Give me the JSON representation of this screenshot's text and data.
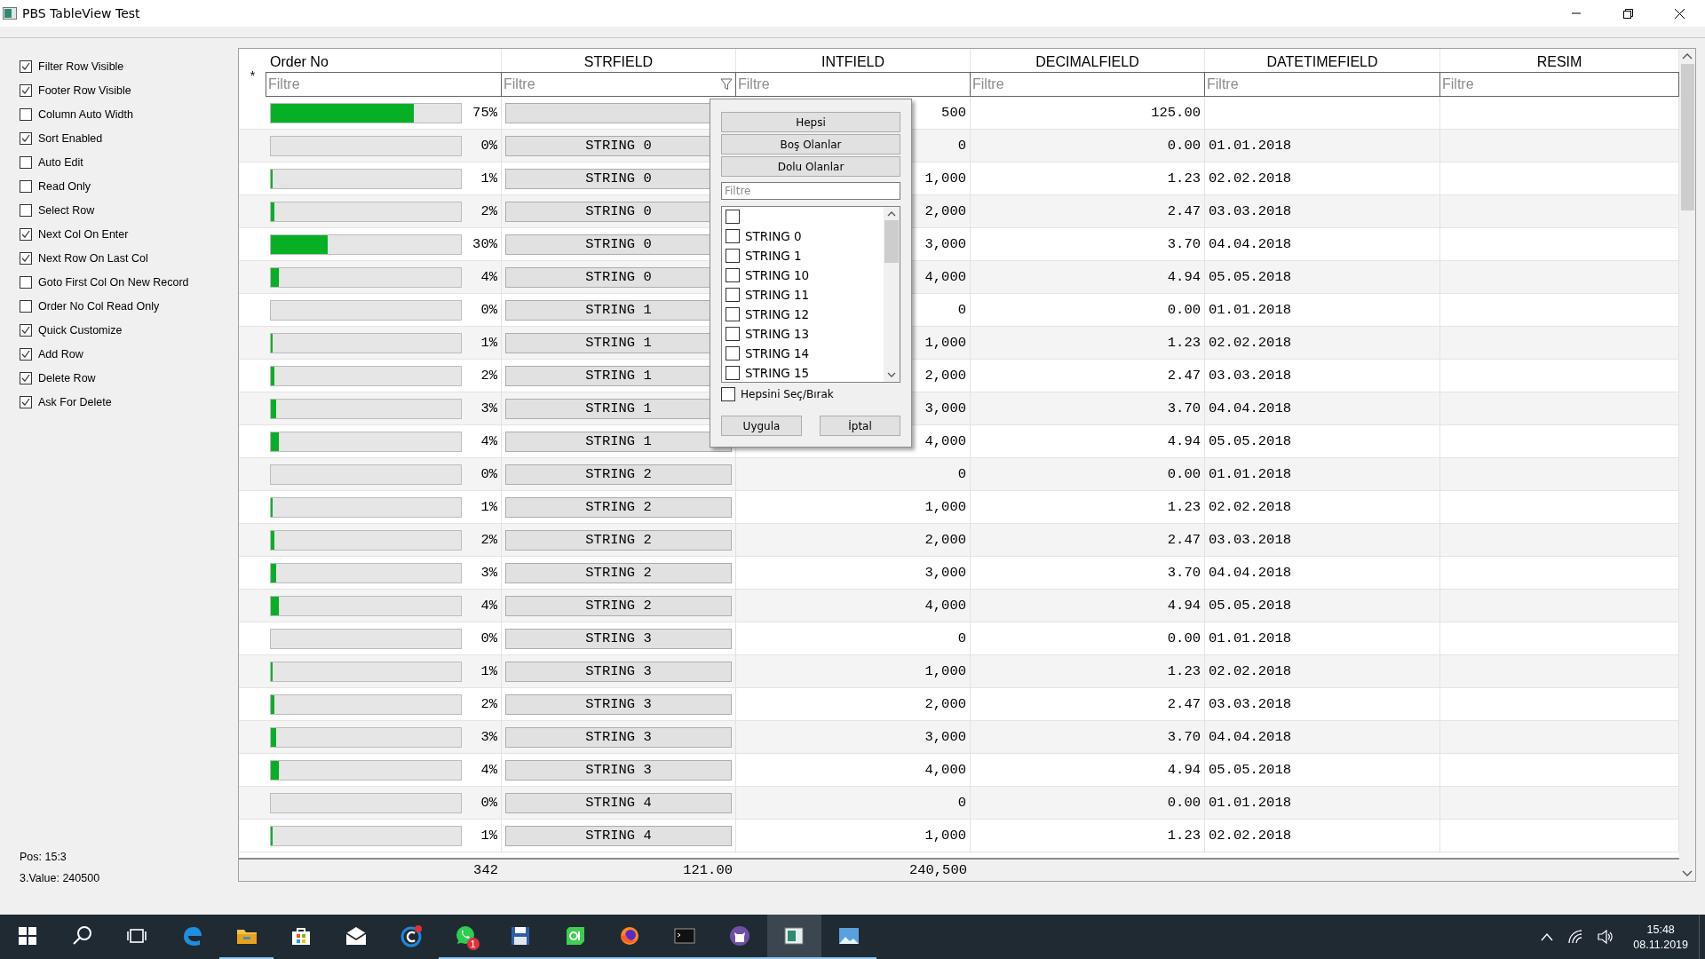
{
  "window": {
    "title": "PBS TableView Test"
  },
  "options": [
    {
      "label": "Filter Row Visible",
      "checked": true
    },
    {
      "label": "Footer Row Visible",
      "checked": true
    },
    {
      "label": "Column Auto Width",
      "checked": false
    },
    {
      "label": "Sort Enabled",
      "checked": true
    },
    {
      "label": "Auto Edit",
      "checked": false
    },
    {
      "label": "Read Only",
      "checked": false
    },
    {
      "label": "Select Row",
      "checked": false
    },
    {
      "label": "Next Col On Enter",
      "checked": true
    },
    {
      "label": "Next Row On Last Col",
      "checked": true
    },
    {
      "label": "Goto First Col On New Record",
      "checked": false
    },
    {
      "label": "Order No Col Read Only",
      "checked": false
    },
    {
      "label": "Quick Customize",
      "checked": true
    },
    {
      "label": "Add Row",
      "checked": true
    },
    {
      "label": "Delete Row",
      "checked": true
    },
    {
      "label": "Ask For Delete",
      "checked": true
    }
  ],
  "status": {
    "pos": "Pos: 15:3",
    "value": "3.Value: 240500"
  },
  "table": {
    "new_row_marker": "*",
    "columns": [
      {
        "title": "Order No",
        "placeholder": "Filtre",
        "filter_button": false
      },
      {
        "title": "STRFIELD",
        "placeholder": "Filtre",
        "filter_button": true
      },
      {
        "title": "INTFIELD",
        "placeholder": "Filtre",
        "filter_button": false
      },
      {
        "title": "DECIMALFIELD",
        "placeholder": "Filtre",
        "filter_button": false
      },
      {
        "title": "DATETIMEFIELD",
        "placeholder": "Filtre",
        "filter_button": false
      },
      {
        "title": "RESIM",
        "placeholder": "Filtre",
        "filter_button": false
      }
    ],
    "rows": [
      {
        "level": 0.75,
        "percent": "75%",
        "intfield": "500",
        "decimalfield": "125.00"
      },
      {
        "level": 0,
        "percent": "0%",
        "strfield": "STRING 0",
        "intfield": "0",
        "decimalfield": "0.00",
        "datetimefield": "01.01.2018"
      },
      {
        "level": 0.01,
        "percent": "1%",
        "strfield": "STRING 0",
        "intfield": "1,000",
        "decimalfield": "1.23",
        "datetimefield": "02.02.2018"
      },
      {
        "level": 0.02,
        "percent": "2%",
        "strfield": "STRING 0",
        "intfield": "2,000",
        "decimalfield": "2.47",
        "datetimefield": "03.03.2018"
      },
      {
        "level": 0.3,
        "percent": "30%",
        "strfield": "STRING 0",
        "intfield": "3,000",
        "decimalfield": "3.70",
        "datetimefield": "04.04.2018"
      },
      {
        "level": 0.04,
        "percent": "4%",
        "strfield": "STRING 0",
        "intfield": "4,000",
        "decimalfield": "4.94",
        "datetimefield": "05.05.2018"
      },
      {
        "level": 0,
        "percent": "0%",
        "strfield": "STRING 1",
        "intfield": "0",
        "decimalfield": "0.00",
        "datetimefield": "01.01.2018"
      },
      {
        "level": 0.01,
        "percent": "1%",
        "strfield": "STRING 1",
        "intfield": "1,000",
        "decimalfield": "1.23",
        "datetimefield": "02.02.2018"
      },
      {
        "level": 0.02,
        "percent": "2%",
        "strfield": "STRING 1",
        "intfield": "2,000",
        "decimalfield": "2.47",
        "datetimefield": "03.03.2018"
      },
      {
        "level": 0.03,
        "percent": "3%",
        "strfield": "STRING 1",
        "intfield": "3,000",
        "decimalfield": "3.70",
        "datetimefield": "04.04.2018"
      },
      {
        "level": 0.04,
        "percent": "4%",
        "strfield": "STRING 1",
        "intfield": "4,000",
        "decimalfield": "4.94",
        "datetimefield": "05.05.2018"
      },
      {
        "level": 0,
        "percent": "0%",
        "strfield": "STRING 2",
        "intfield": "0",
        "decimalfield": "0.00",
        "datetimefield": "01.01.2018"
      },
      {
        "level": 0.01,
        "percent": "1%",
        "strfield": "STRING 2",
        "intfield": "1,000",
        "decimalfield": "1.23",
        "datetimefield": "02.02.2018"
      },
      {
        "level": 0.02,
        "percent": "2%",
        "strfield": "STRING 2",
        "intfield": "2,000",
        "decimalfield": "2.47",
        "datetimefield": "03.03.2018"
      },
      {
        "level": 0.03,
        "percent": "3%",
        "strfield": "STRING 2",
        "intfield": "3,000",
        "decimalfield": "3.70",
        "datetimefield": "04.04.2018"
      },
      {
        "level": 0.04,
        "percent": "4%",
        "strfield": "STRING 2",
        "intfield": "4,000",
        "decimalfield": "4.94",
        "datetimefield": "05.05.2018"
      },
      {
        "level": 0,
        "percent": "0%",
        "strfield": "STRING 3",
        "intfield": "0",
        "decimalfield": "0.00",
        "datetimefield": "01.01.2018"
      },
      {
        "level": 0.01,
        "percent": "1%",
        "strfield": "STRING 3",
        "intfield": "1,000",
        "decimalfield": "1.23",
        "datetimefield": "02.02.2018"
      },
      {
        "level": 0.02,
        "percent": "2%",
        "strfield": "STRING 3",
        "intfield": "2,000",
        "decimalfield": "2.47",
        "datetimefield": "03.03.2018"
      },
      {
        "level": 0.03,
        "percent": "3%",
        "strfield": "STRING 3",
        "intfield": "3,000",
        "decimalfield": "3.70",
        "datetimefield": "04.04.2018"
      },
      {
        "level": 0.04,
        "percent": "4%",
        "strfield": "STRING 3",
        "intfield": "4,000",
        "decimalfield": "4.94",
        "datetimefield": "05.05.2018"
      },
      {
        "level": 0,
        "percent": "0%",
        "strfield": "STRING 4",
        "intfield": "0",
        "decimalfield": "0.00",
        "datetimefield": "01.01.2018"
      },
      {
        "level": 0.01,
        "percent": "1%",
        "strfield": "STRING 4",
        "intfield": "1,000",
        "decimalfield": "1.23",
        "datetimefield": "02.02.2018"
      }
    ],
    "footer": {
      "order_no": "342",
      "strfield": "121.00",
      "intfield": "240,500"
    }
  },
  "filter_popup": {
    "buttons": [
      "Hepsi",
      "Boş Olanlar",
      "Dolu Olanlar"
    ],
    "placeholder": "Filtre",
    "items": [
      {
        "checked": false
      },
      {
        "label": "STRING 0",
        "checked": false
      },
      {
        "label": "STRING 1",
        "checked": false
      },
      {
        "label": "STRING 10",
        "checked": false
      },
      {
        "label": "STRING 11",
        "checked": false
      },
      {
        "label": "STRING 12",
        "checked": false
      },
      {
        "label": "STRING 13",
        "checked": false
      },
      {
        "label": "STRING 14",
        "checked": false
      },
      {
        "label": "STRING 15",
        "checked": false
      }
    ],
    "select_all": {
      "label": "Hepsini Seç/Bırak",
      "checked": false
    },
    "actions": [
      "Uygula",
      "İptal"
    ]
  },
  "taskbar": {
    "apps": [
      {
        "kind": "start",
        "running": false,
        "active": false
      },
      {
        "kind": "search",
        "running": false,
        "active": false
      },
      {
        "kind": "taskview",
        "running": false,
        "active": false
      },
      {
        "kind": "edge",
        "running": false,
        "active": false
      },
      {
        "kind": "folder",
        "running": true,
        "active": false
      },
      {
        "kind": "store",
        "running": false,
        "active": false
      },
      {
        "kind": "mail",
        "running": false,
        "active": false
      },
      {
        "kind": "ring",
        "running": false,
        "active": false
      },
      {
        "kind": "chat",
        "running": true,
        "active": false,
        "badge": "1"
      },
      {
        "kind": "floppy",
        "running": true,
        "active": false
      },
      {
        "kind": "qt",
        "running": true,
        "active": false
      },
      {
        "kind": "fox",
        "running": true,
        "active": false
      },
      {
        "kind": "terminal",
        "running": true,
        "active": false
      },
      {
        "kind": "cat",
        "running": true,
        "active": false
      },
      {
        "kind": "window",
        "running": true,
        "active": true
      },
      {
        "kind": "picture",
        "running": true,
        "active": false
      }
    ],
    "time": "15:48",
    "date": "08.11.2019"
  }
}
